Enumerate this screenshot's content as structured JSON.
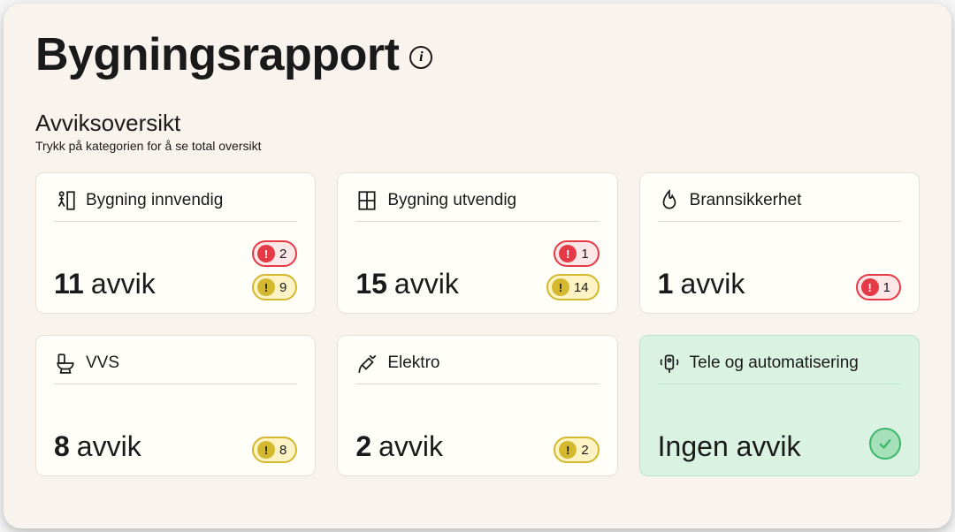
{
  "page_title": "Bygningsrapport",
  "section": {
    "title": "Avviksoversikt",
    "hint": "Trykk på kategorien for å se total oversikt"
  },
  "labels": {
    "deviation": "avvik",
    "no_deviation": "Ingen avvik"
  },
  "cards": [
    {
      "title": "Bygning innvendig",
      "count": "11",
      "red": "2",
      "yellow": "9",
      "ok": false
    },
    {
      "title": "Bygning utvendig",
      "count": "15",
      "red": "1",
      "yellow": "14",
      "ok": false
    },
    {
      "title": "Brannsikkerhet",
      "count": "1",
      "red": "1",
      "yellow": null,
      "ok": false
    },
    {
      "title": "VVS",
      "count": "8",
      "red": null,
      "yellow": "8",
      "ok": false
    },
    {
      "title": "Elektro",
      "count": "2",
      "red": null,
      "yellow": "2",
      "ok": false
    },
    {
      "title": "Tele og automatisering",
      "count": null,
      "red": null,
      "yellow": null,
      "ok": true
    }
  ]
}
